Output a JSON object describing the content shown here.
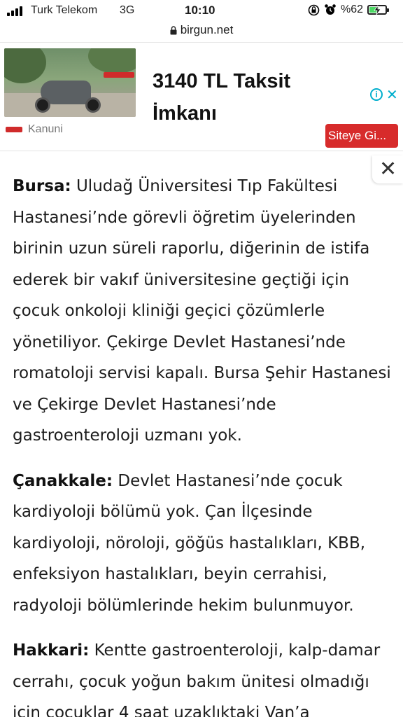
{
  "status_bar": {
    "carrier": "Turk Telekom",
    "network": "3G",
    "time": "10:10",
    "battery_percent": "%62",
    "battery_level": 0.62,
    "icons": [
      "signal-icon",
      "orientation-lock-icon",
      "alarm-icon",
      "battery-charging-icon"
    ]
  },
  "browser": {
    "url": "birgun.net",
    "lock_icon": "lock-icon"
  },
  "ad": {
    "headline": "3140 TL Taksit İmkanı",
    "cta_label": "Siteye Gi...",
    "info_icon": "i",
    "close_icon": "✕",
    "advertiser": "Kanuni",
    "accent_color": "#d72b2b"
  },
  "close_button": {
    "label": "✕"
  },
  "article": {
    "paragraphs": [
      {
        "city": "Bursa:",
        "text": " Uludağ Üniversitesi Tıp Fakültesi Hastanesi’nde görevli öğretim üyelerinden birinin uzun süreli raporlu, diğerinin de istifa ederek bir vakıf üniversitesine geçtiği için çocuk onkoloji kliniği geçici çözümlerle yönetiliyor. Çekirge Devlet Hastanesi’nde romatoloji servisi kapalı. Bursa Şehir Hastanesi ve Çekirge Devlet Hastanesi’nde gastroenteroloji uzmanı yok."
      },
      {
        "city": "Çanakkale:",
        "text": " Devlet Hastanesi’nde çocuk kardiyoloji bölümü yok. Çan İlçesinde kardiyoloji, nöroloji, göğüs hastalıkları, KBB, enfeksiyon hastalıkları, beyin cerrahisi, radyoloji bölümlerinde hekim bulunmuyor."
      },
      {
        "city": "Hakkari:",
        "text": " Kentte gastroenteroloji, kalp-damar cerrahı, çocuk yoğun bakım ünitesi olmadığı için çocuklar 4 saat uzaklıktaki Van’a"
      }
    ]
  }
}
